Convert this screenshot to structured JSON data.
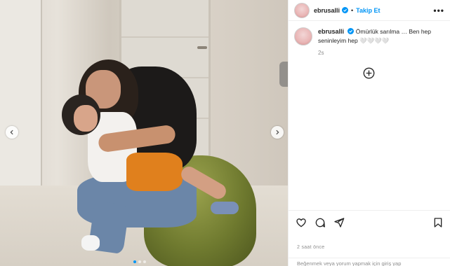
{
  "post": {
    "username": "ebrusalli",
    "follow_label": "Takip Et",
    "separator": "•",
    "more_label": "•••",
    "caption_text": "Ömürlük sarılma … Ben hep seninleyim hep 🤍🤍🤍🤍",
    "caption_time": "2s",
    "post_time": "2 saat önce",
    "login_prompt": "Beğenmek veya yorum yapmak için giriş yap"
  },
  "carousel": {
    "total": 3,
    "active": 1
  },
  "colors": {
    "accent": "#0095f6",
    "text": "#262626",
    "muted": "#8e8e8e"
  },
  "icons": {
    "prev": "chevron-left-icon",
    "next": "chevron-right-icon",
    "verified": "verified-badge-icon",
    "add": "add-circle-icon",
    "like": "heart-icon",
    "comment": "comment-icon",
    "share": "send-icon",
    "save": "bookmark-icon"
  }
}
